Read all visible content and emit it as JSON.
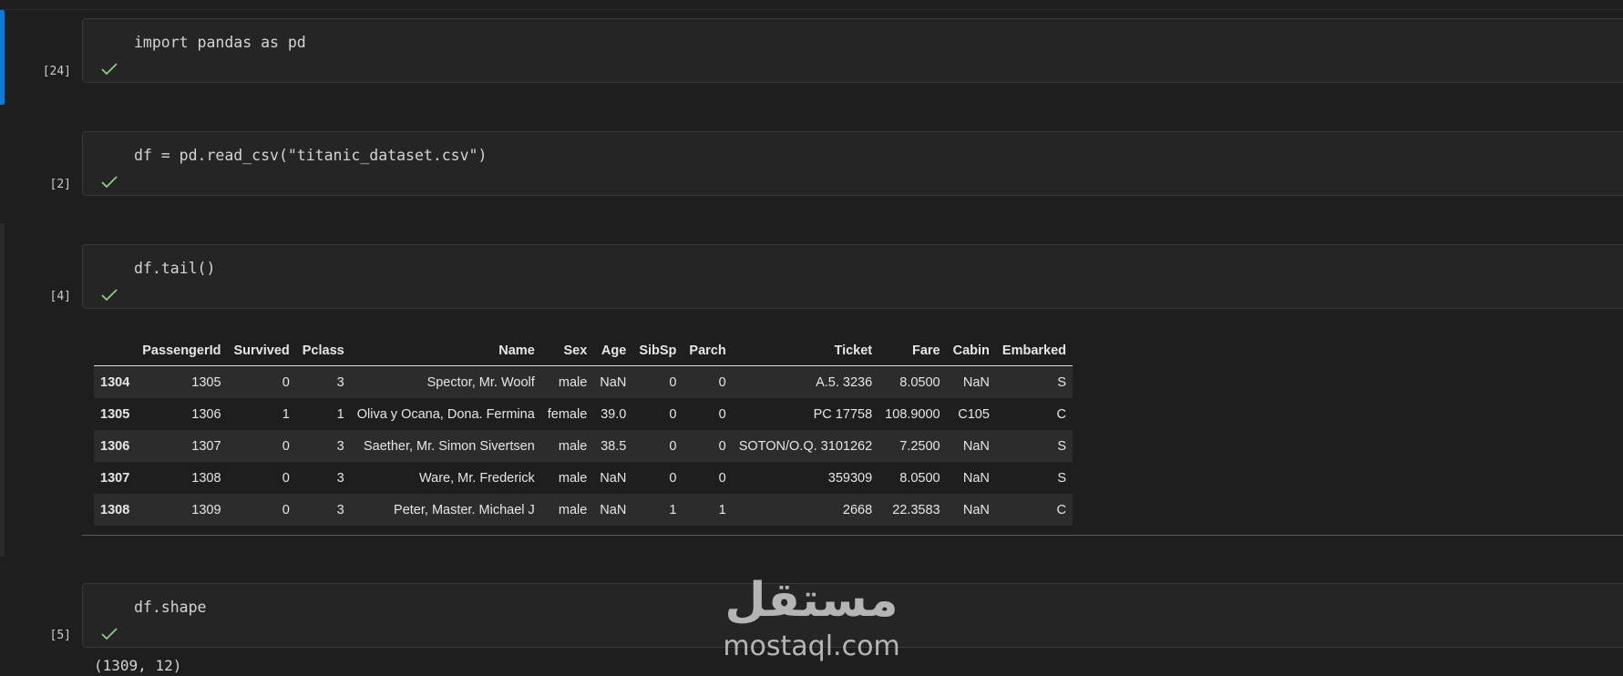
{
  "cells": [
    {
      "code": "import pandas as pd",
      "exec_count": "[24]"
    },
    {
      "code": "df = pd.read_csv(\"titanic_dataset.csv\")",
      "exec_count": "[2]"
    },
    {
      "code": "df.tail()",
      "exec_count": "[4]"
    },
    {
      "code": "df.shape",
      "exec_count": "[5]"
    }
  ],
  "status_icon": "check-icon",
  "status_color": "#89d185",
  "accent_color": "#0e7ad6",
  "dataframe": {
    "columns": [
      "",
      "PassengerId",
      "Survived",
      "Pclass",
      "Name",
      "Sex",
      "Age",
      "SibSp",
      "Parch",
      "Ticket",
      "Fare",
      "Cabin",
      "Embarked"
    ],
    "rows": [
      [
        "1304",
        "1305",
        "0",
        "3",
        "Spector, Mr. Woolf",
        "male",
        "NaN",
        "0",
        "0",
        "A.5. 3236",
        "8.0500",
        "NaN",
        "S"
      ],
      [
        "1305",
        "1306",
        "1",
        "1",
        "Oliva y Ocana, Dona. Fermina",
        "female",
        "39.0",
        "0",
        "0",
        "PC 17758",
        "108.9000",
        "C105",
        "C"
      ],
      [
        "1306",
        "1307",
        "0",
        "3",
        "Saether, Mr. Simon Sivertsen",
        "male",
        "38.5",
        "0",
        "0",
        "SOTON/O.Q. 3101262",
        "7.2500",
        "NaN",
        "S"
      ],
      [
        "1307",
        "1308",
        "0",
        "3",
        "Ware, Mr. Frederick",
        "male",
        "NaN",
        "0",
        "0",
        "359309",
        "8.0500",
        "NaN",
        "S"
      ],
      [
        "1308",
        "1309",
        "0",
        "3",
        "Peter, Master. Michael J",
        "male",
        "NaN",
        "1",
        "1",
        "2668",
        "22.3583",
        "NaN",
        "C"
      ]
    ]
  },
  "shape_output": "(1309, 12)",
  "watermark": {
    "arabic": "مستقل",
    "latin": "mostaql.com"
  }
}
